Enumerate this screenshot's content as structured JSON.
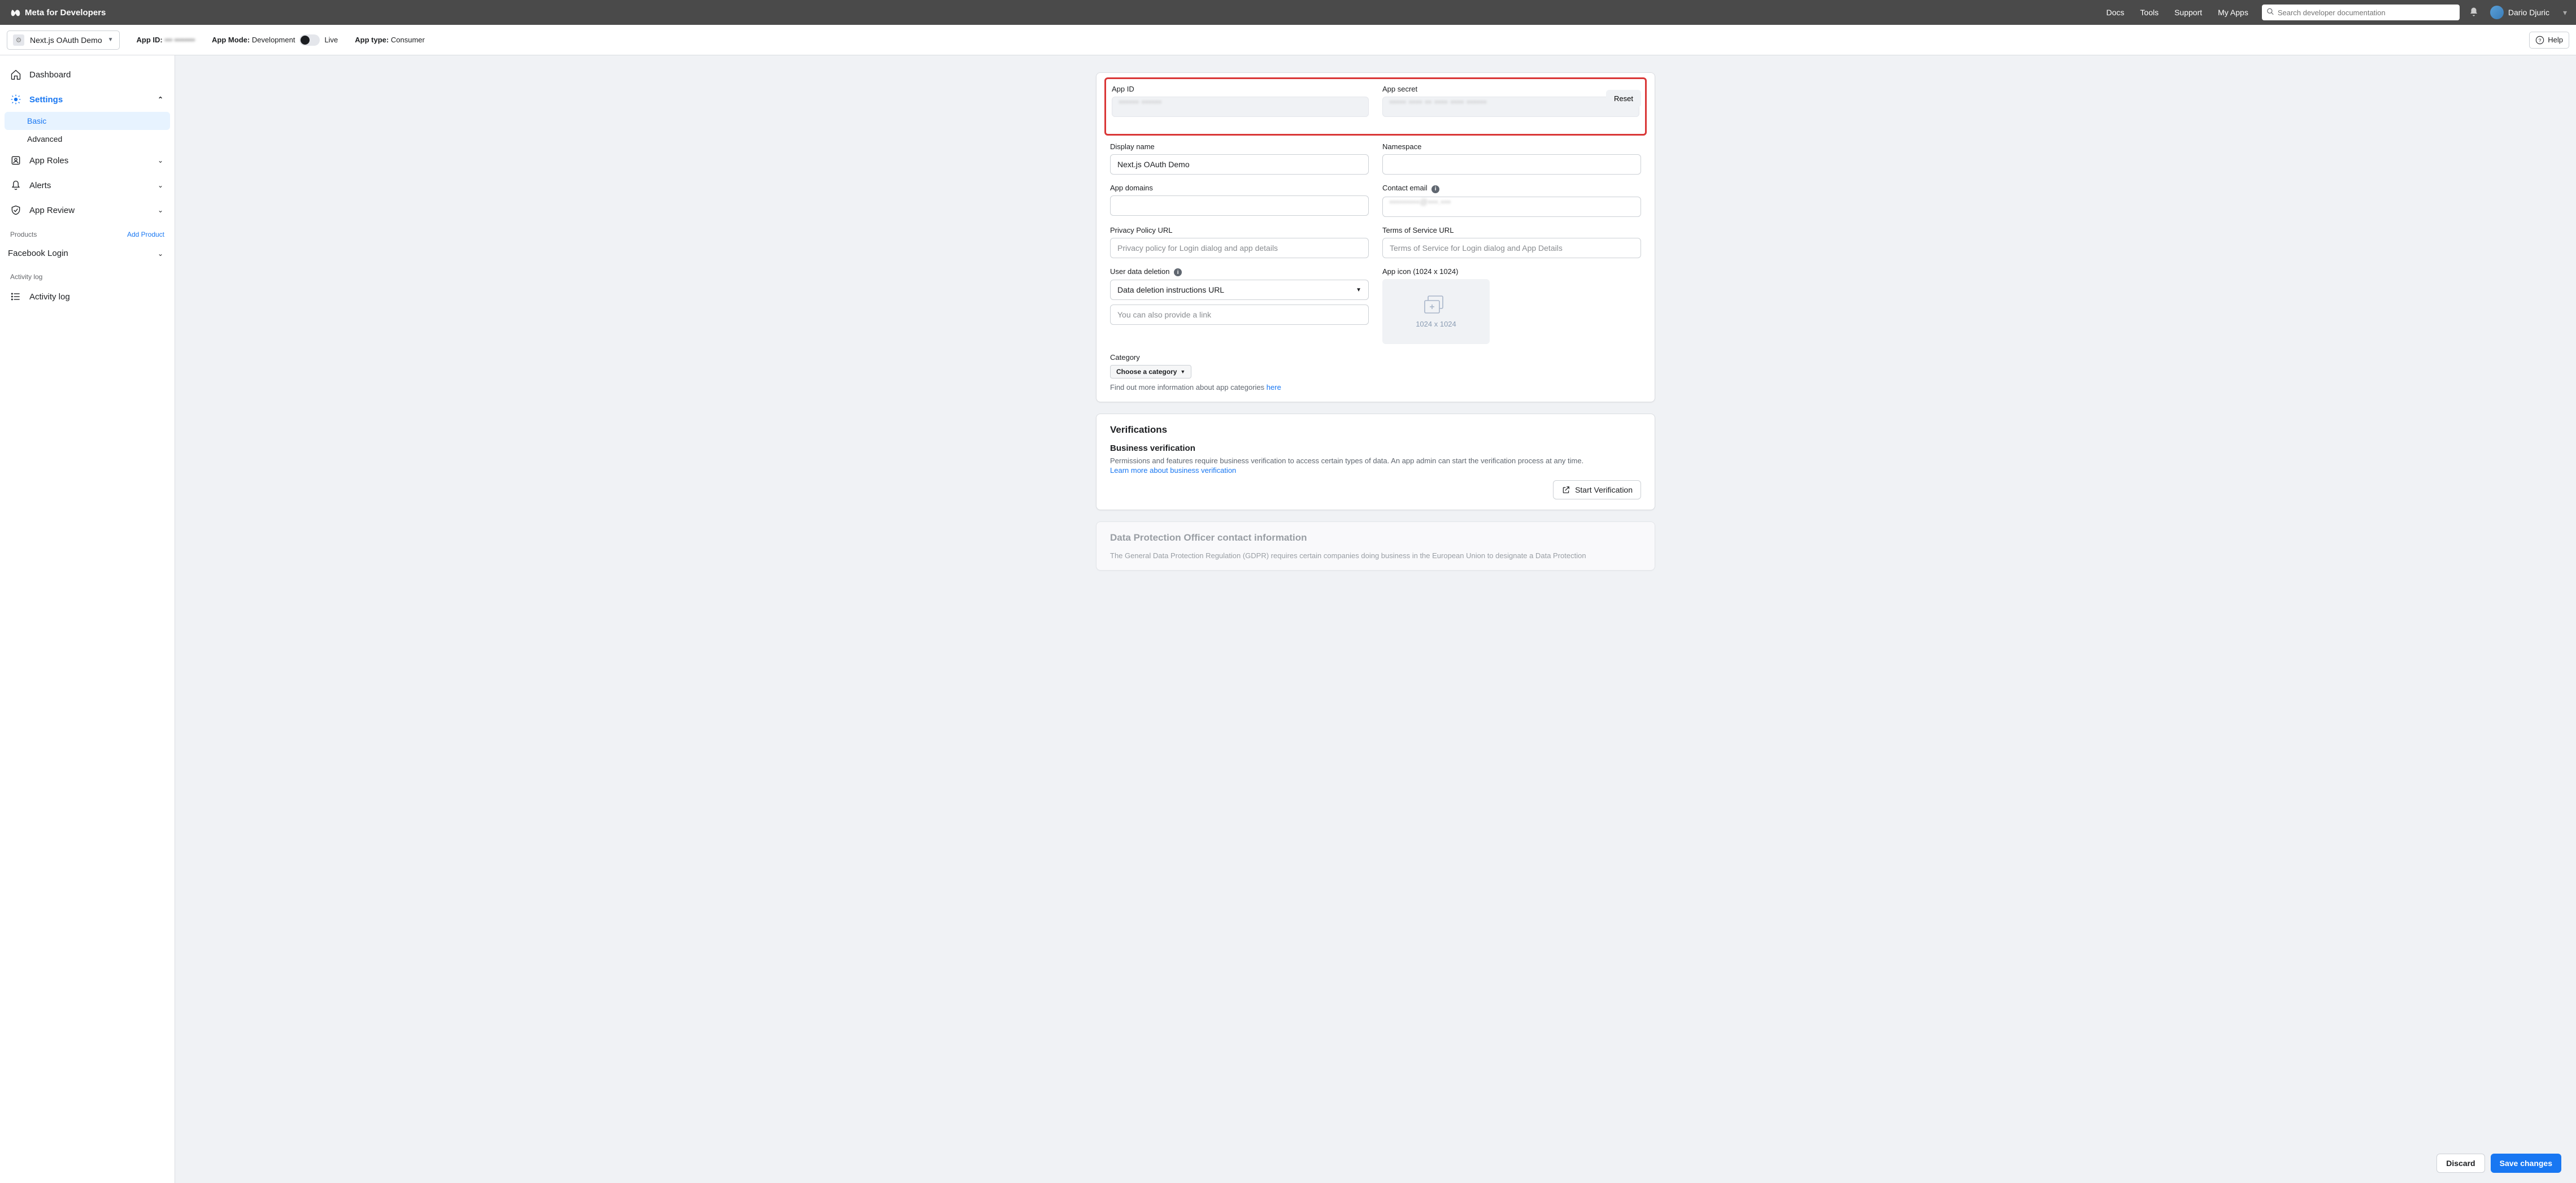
{
  "topnav": {
    "brand": "Meta for Developers",
    "links": [
      "Docs",
      "Tools",
      "Support",
      "My Apps"
    ],
    "search_placeholder": "Search developer documentation",
    "user_name": "Dario Djuric"
  },
  "appbar": {
    "app_name": "Next.js OAuth Demo",
    "app_id_label": "App ID:",
    "app_id_value": "•••  ••••••••",
    "mode_label": "App Mode:",
    "mode_value": "Development",
    "live_label": "Live",
    "type_label": "App type:",
    "type_value": "Consumer",
    "help": "Help"
  },
  "sidebar": {
    "dashboard": "Dashboard",
    "settings": "Settings",
    "settings_basic": "Basic",
    "settings_advanced": "Advanced",
    "app_roles": "App Roles",
    "alerts": "Alerts",
    "app_review": "App Review",
    "products_label": "Products",
    "add_product": "Add Product",
    "facebook_login": "Facebook Login",
    "activity_log_label": "Activity log",
    "activity_log": "Activity log"
  },
  "form": {
    "app_id_label": "App ID",
    "app_id_value": "••••••  ••••••",
    "app_secret_label": "App secret",
    "app_secret_value": "••••• •••• •• •••• •••• ••••••",
    "reset": "Reset",
    "display_name_label": "Display name",
    "display_name_value": "Next.js OAuth Demo",
    "namespace_label": "Namespace",
    "app_domains_label": "App domains",
    "contact_email_label": "Contact email",
    "contact_email_value": "•••••••••@•••.•••",
    "privacy_label": "Privacy Policy URL",
    "privacy_placeholder": "Privacy policy for Login dialog and app details",
    "tos_label": "Terms of Service URL",
    "tos_placeholder": "Terms of Service for Login dialog and App Details",
    "user_data_label": "User data deletion",
    "user_data_select": "Data deletion instructions URL",
    "user_data_placeholder": "You can also provide a link",
    "app_icon_label": "App icon (1024 x 1024)",
    "app_icon_size": "1024 x 1024",
    "category_label": "Category",
    "category_button": "Choose a category",
    "category_help": "Find out more information about app categories ",
    "category_link": "here"
  },
  "verifications": {
    "title": "Verifications",
    "subtitle": "Business verification",
    "desc": "Permissions and features require business verification to access certain types of data. An app admin can start the verification process at any time.",
    "learn_more": "Learn more about business verification",
    "start": "Start Verification"
  },
  "dpo": {
    "title": "Data Protection Officer contact information",
    "desc": "The General Data Protection Regulation (GDPR) requires certain companies doing business in the European Union to designate a Data Protection"
  },
  "footer": {
    "discard": "Discard",
    "save": "Save changes"
  }
}
